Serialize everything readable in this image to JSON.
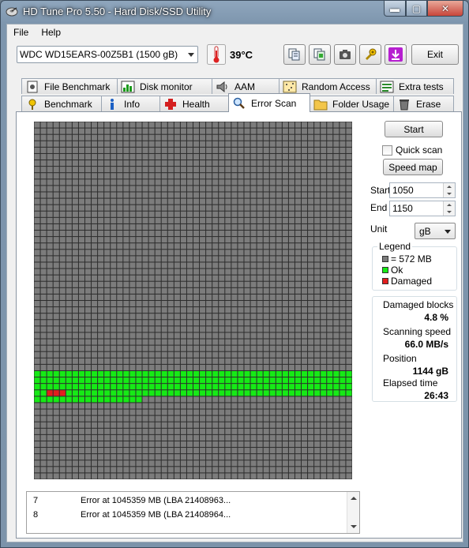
{
  "window": {
    "title": "HD Tune Pro 5.50 - Hard Disk/SSD Utility",
    "controls": {
      "minimize": "▬",
      "maximize": "▢",
      "close": "✕"
    }
  },
  "menu": {
    "file": "File",
    "help": "Help"
  },
  "toolbar": {
    "drive": "WDC WD15EARS-00Z5B1 (1500 gB)",
    "temperature": "39°C",
    "exit_label": "Exit",
    "tool_icons": [
      "copy-text-icon",
      "copy-screen-icon",
      "camera-icon",
      "options-icon",
      "save-icon"
    ]
  },
  "tabs": {
    "upper": [
      "File Benchmark",
      "Disk monitor",
      "AAM",
      "Random Access",
      "Extra tests"
    ],
    "lower": [
      "Benchmark",
      "Info",
      "Health",
      "Error Scan",
      "Folder Usage",
      "Erase"
    ],
    "active": "Error Scan"
  },
  "side": {
    "start_button": "Start",
    "quick_scan_label": "Quick scan",
    "quick_scan_checked": false,
    "speed_map_button": "Speed map",
    "start_label": "Start",
    "start_value": "1050",
    "end_label": "End",
    "end_value": "1150",
    "unit_label": "Unit",
    "unit_value": "gB"
  },
  "legend": {
    "title": "Legend",
    "block": "= 572 MB",
    "ok": "Ok",
    "damaged": "Damaged"
  },
  "stats": {
    "damaged_blocks_label": "Damaged blocks",
    "damaged_blocks_value": "4.8 %",
    "scanning_speed_label": "Scanning speed",
    "scanning_speed_value": "66.0 MB/s",
    "position_label": "Position",
    "position_value": "1144 gB",
    "elapsed_label": "Elapsed time",
    "elapsed_value": "26:43"
  },
  "colors": {
    "unscanned": "#7c7c7c",
    "ok": "#16ea16",
    "damaged": "#e21e1e",
    "grid_line": "#2c2c2c"
  },
  "scan_map": {
    "columns": 50,
    "rows": 56,
    "ok_blocks": 217,
    "damaged_blocks": [
      152,
      153,
      154
    ]
  },
  "log": [
    {
      "index": "7",
      "message": "Error at 1045359 MB (LBA 21408963..."
    },
    {
      "index": "8",
      "message": "Error at 1045359 MB (LBA 21408964..."
    }
  ]
}
